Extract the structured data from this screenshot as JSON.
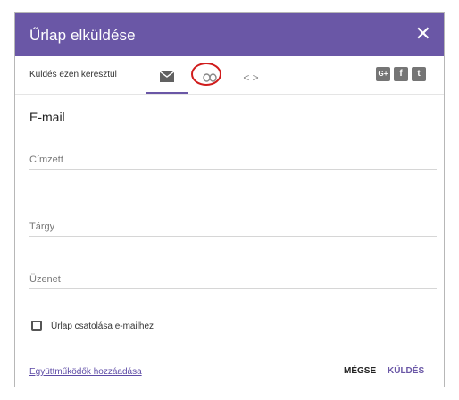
{
  "dialog": {
    "title": "Űrlap elküldése",
    "close_glyph": "✕"
  },
  "toolbar": {
    "send_via_label": "Küldés ezen keresztül",
    "tabs": [
      {
        "name": "email",
        "icon": "envelope-icon"
      },
      {
        "name": "link",
        "icon": "link-icon"
      },
      {
        "name": "embed",
        "icon": "code-icon",
        "glyph": "< >"
      }
    ],
    "social": [
      {
        "name": "google-plus",
        "glyph": "G+"
      },
      {
        "name": "facebook",
        "glyph": "f"
      },
      {
        "name": "twitter",
        "glyph": "t"
      }
    ]
  },
  "form": {
    "section_title": "E-mail",
    "to_label": "Címzett",
    "subject_label": "Tárgy",
    "message_label": "Üzenet",
    "attach_label": "Űrlap csatolása e-mailhez"
  },
  "footer": {
    "collaborators_link": "Együttműködők hozzáadása",
    "cancel_label": "MÉGSE",
    "send_label": "KÜLDÉS"
  },
  "colors": {
    "accent": "#6a57a6",
    "highlight_circle": "#d01c1c"
  }
}
